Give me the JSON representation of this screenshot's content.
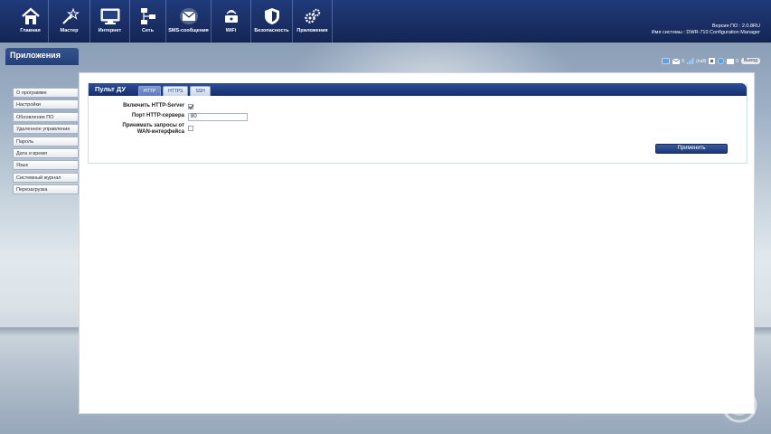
{
  "nav": {
    "items": [
      {
        "label": "Главная",
        "icon": "home-icon"
      },
      {
        "label": "Мастер",
        "icon": "wizard-icon"
      },
      {
        "label": "Интернет",
        "icon": "monitor-icon"
      },
      {
        "label": "Сеть",
        "icon": "network-icon"
      },
      {
        "label": "SMS-сообщения",
        "icon": "envelope-icon"
      },
      {
        "label": "WiFi",
        "icon": "wifi-icon"
      },
      {
        "label": "Безопасность",
        "icon": "shield-icon"
      },
      {
        "label": "Приложения",
        "icon": "gears-icon"
      }
    ]
  },
  "system": {
    "version_line": "Версия ПО : 2.0.8RU",
    "name_line": "Имя системы : DWR-710 Configuration Manager"
  },
  "section": {
    "title": "Приложения"
  },
  "status": {
    "sms_count": "0",
    "signal_text": "(null)",
    "updates_count": "0",
    "logout_label": "Выход"
  },
  "sidebar": {
    "items": [
      {
        "label": "О программе"
      },
      {
        "label": "Настройки"
      },
      {
        "label": "Обновление ПО"
      },
      {
        "label": "Удаленное управление"
      },
      {
        "label": "Пароль"
      },
      {
        "label": "Дата и время"
      },
      {
        "label": "Язык"
      },
      {
        "label": "Системный журнал"
      },
      {
        "label": "Перезагрузка"
      }
    ]
  },
  "panel": {
    "title": "Пульт ДУ",
    "tabs": [
      {
        "label": "HTTP",
        "active": true
      },
      {
        "label": "HTTPS",
        "active": false
      },
      {
        "label": "SSH",
        "active": false
      }
    ],
    "form": {
      "enable_label": "Включить HTTP-Server",
      "enable_checked": true,
      "port_label": "Порт HTTP-сервера",
      "port_value": "80",
      "wan_label_line1": "Принимать запросы от",
      "wan_label_line2": "WAN-интерфейса",
      "wan_checked": false
    },
    "apply_label": "Применить"
  },
  "colors": {
    "navbar": "#1a2f66",
    "accent": "#1f3a7e",
    "tab_active": "#5d79bb"
  }
}
